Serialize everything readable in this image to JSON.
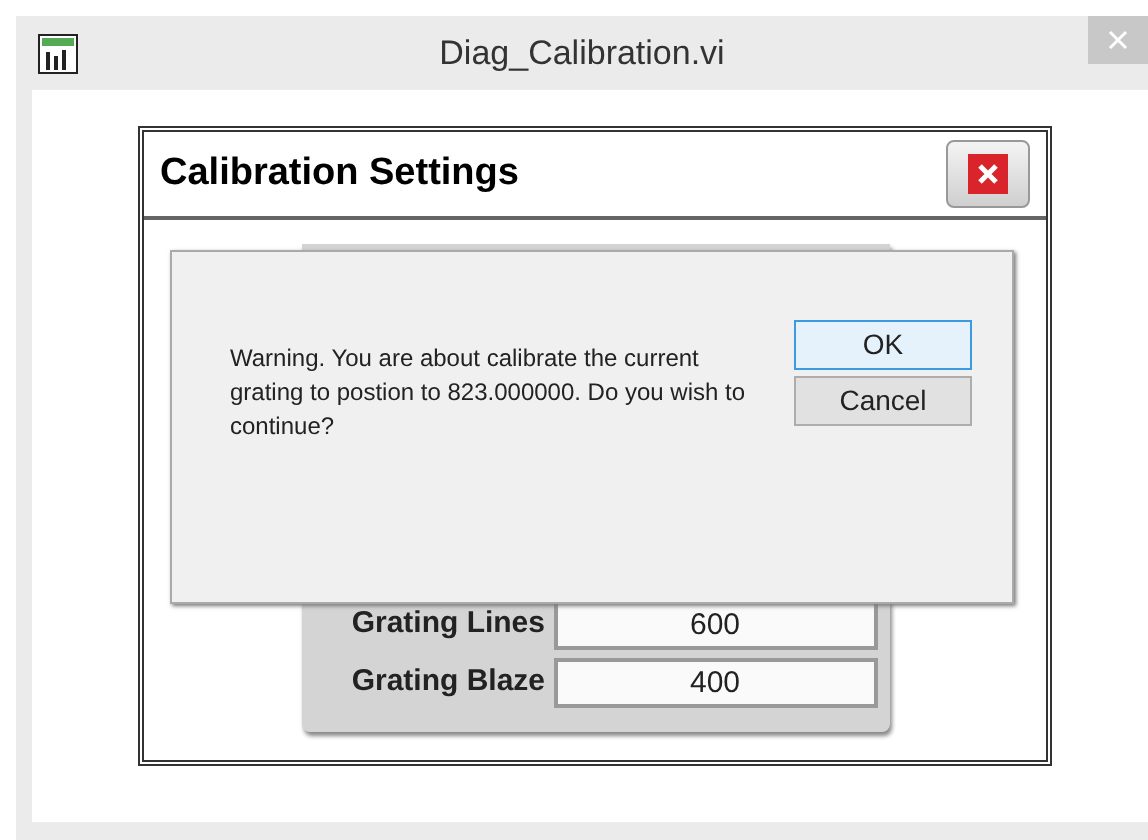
{
  "window": {
    "title": "Diag_Calibration.vi"
  },
  "panel": {
    "title": "Calibration Settings"
  },
  "fields": [
    {
      "label": "Grating Lines",
      "value": "600"
    },
    {
      "label": "Grating Blaze",
      "value": "400"
    }
  ],
  "dialog": {
    "message": "Warning. You are about calibrate the current grating to postion to 823.000000. Do you wish to continue?",
    "buttons": [
      {
        "label": "OK",
        "selected": true
      },
      {
        "label": "Cancel",
        "selected": false
      }
    ]
  }
}
